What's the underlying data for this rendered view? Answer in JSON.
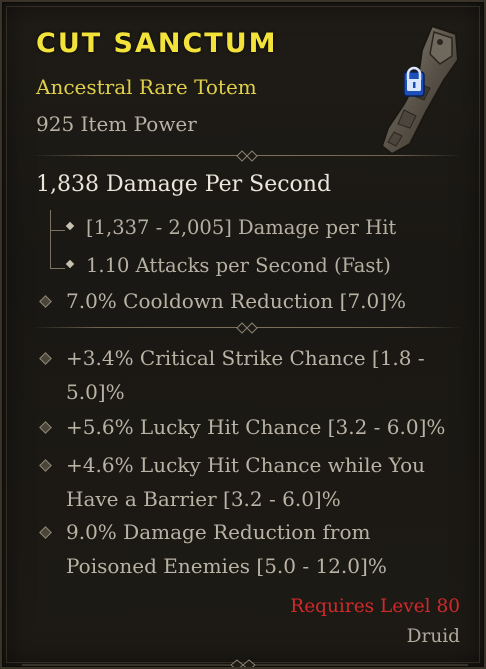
{
  "item": {
    "name": "CUT SANCTUM",
    "type_line": "Ancestral Rare Totem",
    "item_power": "925 Item Power"
  },
  "stats": {
    "dps": "1,838 Damage Per Second",
    "damage_per_hit": "[1,337 - 2,005] Damage per Hit",
    "attacks_per_second": "1.10 Attacks per Second (Fast)",
    "implicit": "7.0% Cooldown Reduction [7.0]%"
  },
  "affixes": [
    {
      "line1": "+3.4% Critical Strike Chance [1.8 -",
      "line2": "5.0]%"
    },
    {
      "line1": "+5.6% Lucky Hit Chance [3.2 - 6.0]%",
      "line2": ""
    },
    {
      "line1": "+4.6% Lucky Hit Chance while You",
      "line2": "Have a Barrier [3.2 - 6.0]%"
    },
    {
      "line1": "9.0% Damage Reduction from",
      "line2": "Poisoned Enemies [5.0 - 12.0]%"
    }
  ],
  "requirements": {
    "level": "Requires Level 80",
    "class": "Druid"
  },
  "icons": {
    "item_art": "totem-item-icon",
    "lock": "lock-icon"
  },
  "colors": {
    "title": "#f2e23a",
    "rarity": "#e0cf4a",
    "requirement": "#d3282a"
  }
}
